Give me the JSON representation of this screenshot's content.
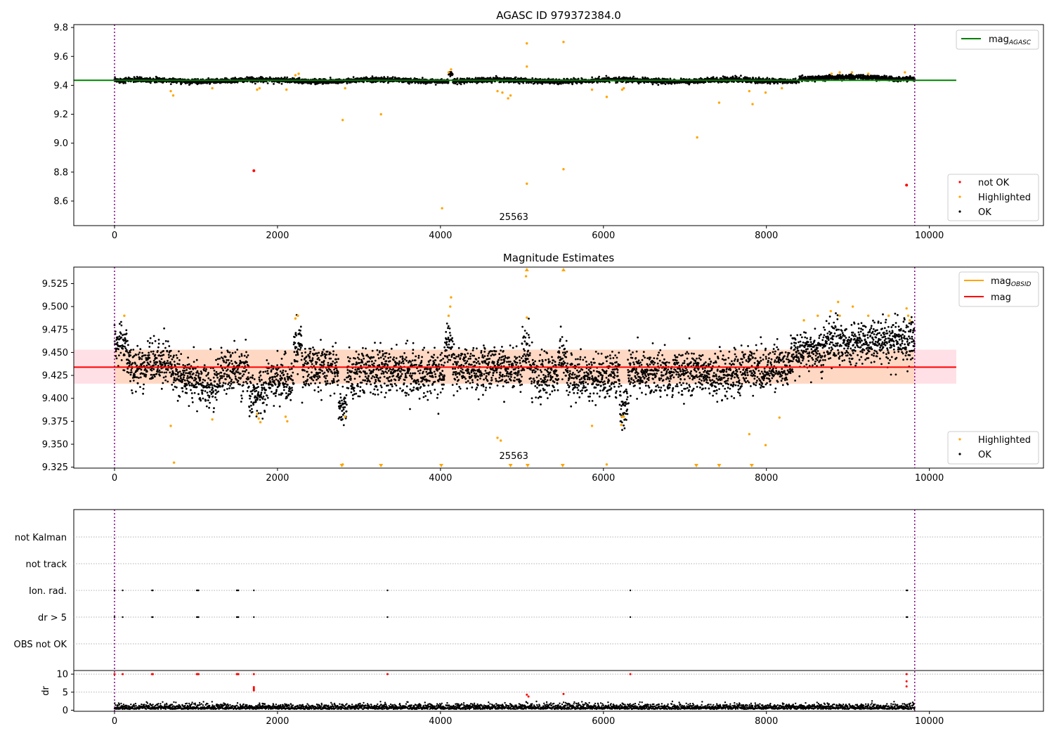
{
  "chart_data": [
    {
      "type": "scatter",
      "title": "AGASC ID 979372384.0",
      "xlim": [
        -500,
        11400
      ],
      "ylim": [
        8.43,
        9.82
      ],
      "xticks": [
        0,
        2000,
        4000,
        6000,
        8000,
        10000
      ],
      "yticks": [
        8.6,
        8.8,
        9.0,
        9.2,
        9.4,
        9.6,
        9.8
      ],
      "ytick_labels": [
        "8.6",
        "8.8",
        "9.0",
        "9.2",
        "9.4",
        "9.6",
        "9.8"
      ],
      "vlines": [
        0,
        9820
      ],
      "annotation": {
        "text": "25563",
        "x": 4900,
        "y": 8.47
      },
      "mag_agasc": {
        "label_main": "mag",
        "label_sub": "AGASC",
        "value": 9.435,
        "x": [
          -500,
          10330
        ],
        "color": "#008000"
      },
      "ok_band": {
        "center": 9.433,
        "half_width": 0.018,
        "x": [
          0,
          9820
        ],
        "color": "#000000"
      },
      "points": {
        "not_ok": {
          "label": "not OK",
          "color": "#ff0000",
          "x": [
            1710,
            9720
          ],
          "y": [
            8.81,
            8.71
          ]
        },
        "highlighted": {
          "label": "Highlighted",
          "color": "#ffa500",
          "x": [
            690,
            720,
            1200,
            1750,
            1780,
            2110,
            2220,
            2260,
            2800,
            2830,
            3270,
            4020,
            4100,
            4130,
            4700,
            4760,
            4830,
            4860,
            5060,
            5060,
            5060,
            5510,
            5510,
            5860,
            6040,
            6230,
            6250,
            7150,
            7420,
            7790,
            7830,
            7990,
            8190,
            8800,
            8900,
            9050,
            9250,
            9700
          ],
          "y": [
            9.36,
            9.33,
            9.38,
            9.37,
            9.38,
            9.37,
            9.47,
            9.48,
            9.16,
            9.38,
            9.2,
            8.55,
            9.49,
            9.51,
            9.36,
            9.35,
            9.31,
            9.33,
            9.69,
            9.53,
            8.72,
            9.7,
            8.82,
            9.37,
            9.32,
            9.37,
            9.38,
            9.04,
            9.28,
            9.36,
            9.27,
            9.35,
            9.38,
            9.48,
            9.49,
            9.49,
            9.48,
            9.49
          ]
        },
        "ok": {
          "label": "OK",
          "color": "#000000"
        }
      },
      "legend_line": "top-right",
      "legend_points": "bottom-right"
    },
    {
      "type": "scatter",
      "title": "Magnitude Estimates",
      "xlim": [
        -500,
        11400
      ],
      "ylim": [
        9.324,
        9.543
      ],
      "xticks": [
        0,
        2000,
        4000,
        6000,
        8000,
        10000
      ],
      "yticks": [
        9.325,
        9.35,
        9.375,
        9.4,
        9.425,
        9.45,
        9.475,
        9.5,
        9.525
      ],
      "ytick_labels": [
        "9.325",
        "9.350",
        "9.375",
        "9.400",
        "9.425",
        "9.450",
        "9.475",
        "9.500",
        "9.525"
      ],
      "vlines": [
        0,
        9820
      ],
      "annotation": {
        "text": "25563",
        "x": 4900,
        "y": 9.334
      },
      "mag": {
        "label": "mag",
        "value": 9.434,
        "x": [
          -500,
          10330
        ],
        "color": "#ff0000"
      },
      "mag_obsid": {
        "label_main": "mag",
        "label_sub": "OBSID",
        "color": "#ffa500"
      },
      "error_band": {
        "y": [
          9.416,
          9.453
        ],
        "x": [
          -500,
          10330
        ],
        "color_light": "#ffe0e6",
        "color_dark": "#ffd8c4",
        "dark_x": [
          0,
          9820
        ]
      },
      "segments": [
        [
          0,
          150,
          9.46
        ],
        [
          150,
          400,
          9.435
        ],
        [
          400,
          700,
          9.44
        ],
        [
          700,
          1000,
          9.425
        ],
        [
          1000,
          1300,
          9.415
        ],
        [
          1300,
          1650,
          9.43
        ],
        [
          1650,
          1850,
          9.405
        ],
        [
          1850,
          2200,
          9.42
        ],
        [
          2200,
          2300,
          9.46
        ],
        [
          2300,
          2750,
          9.432
        ],
        [
          2750,
          2850,
          9.392
        ],
        [
          2850,
          4050,
          9.428
        ],
        [
          4050,
          4150,
          9.46
        ],
        [
          4150,
          5000,
          9.432
        ],
        [
          5000,
          5100,
          9.45
        ],
        [
          5100,
          5450,
          9.425
        ],
        [
          5450,
          5550,
          9.445
        ],
        [
          5550,
          6200,
          9.422
        ],
        [
          6200,
          6300,
          9.39
        ],
        [
          6300,
          7300,
          9.428
        ],
        [
          7300,
          7700,
          9.423
        ],
        [
          7700,
          8300,
          9.432
        ],
        [
          8300,
          8700,
          9.45
        ],
        [
          8700,
          9300,
          9.46
        ],
        [
          9300,
          9820,
          9.462
        ]
      ],
      "points": {
        "highlighted": {
          "label": "Highlighted",
          "color": "#ffa500",
          "x": [
            120,
            690,
            730,
            1200,
            1750,
            1770,
            1790,
            2100,
            2120,
            2220,
            2250,
            2800,
            2830,
            4100,
            4120,
            4130,
            4700,
            4740,
            5050,
            5060,
            5860,
            6040,
            6220,
            6230,
            6250,
            7790,
            7990,
            8160,
            8460,
            8630,
            8790,
            8880,
            8900,
            9060,
            9250,
            9500,
            9720,
            9740,
            9760
          ],
          "y": [
            9.49,
            9.37,
            9.33,
            9.377,
            9.383,
            9.378,
            9.374,
            9.38,
            9.375,
            9.487,
            9.49,
            9.328,
            9.38,
            9.49,
            9.5,
            9.51,
            9.357,
            9.354,
            9.533,
            9.488,
            9.37,
            9.328,
            9.371,
            9.38,
            9.38,
            9.361,
            9.349,
            9.379,
            9.485,
            9.49,
            9.495,
            9.505,
            9.49,
            9.5,
            9.49,
            9.49,
            9.498,
            9.49,
            9.485
          ]
        },
        "ok": {
          "label": "OK",
          "color": "#000000"
        }
      },
      "offscale_down_x": [
        2790,
        3270,
        4010,
        4860,
        5070,
        5500,
        7140,
        7420,
        7820
      ],
      "offscale_up_x": [
        5060,
        5510
      ],
      "legend_line": "top-right",
      "legend_points": "bottom-right"
    },
    {
      "type": "scatter",
      "title": "",
      "xlim": [
        -500,
        11400
      ],
      "flag_rows": [
        "not Kalman",
        "not track",
        "Ion. rad.",
        "dr > 5",
        "OBS not OK"
      ],
      "flag_events_x": [
        0,
        100,
        460,
        470,
        1010,
        1020,
        1030,
        1500,
        1510,
        1520,
        1710,
        3350,
        6330,
        9720,
        9730
      ],
      "vlines": [
        0,
        9820
      ],
      "dr": {
        "ylabel": "dr",
        "ylim": [
          -0.3,
          11
        ],
        "yticks": [
          0,
          5,
          10
        ],
        "ytick_labels": [
          "0",
          "5",
          "10"
        ],
        "xticks": [
          0,
          2000,
          4000,
          6000,
          8000,
          10000
        ],
        "red_points": {
          "x": [
            0,
            100,
            460,
            470,
            1010,
            1020,
            1030,
            1500,
            1510,
            1520,
            1710,
            1710,
            1710,
            1710,
            3350,
            5060,
            5080,
            5510,
            6330,
            9720,
            9720,
            9720
          ],
          "y": [
            10,
            10,
            10,
            10,
            10,
            10,
            10,
            10,
            10,
            10,
            10,
            6.4,
            5.9,
            5.5,
            10,
            4.3,
            3.8,
            4.5,
            10,
            10,
            8.0,
            6.6
          ]
        }
      }
    }
  ]
}
